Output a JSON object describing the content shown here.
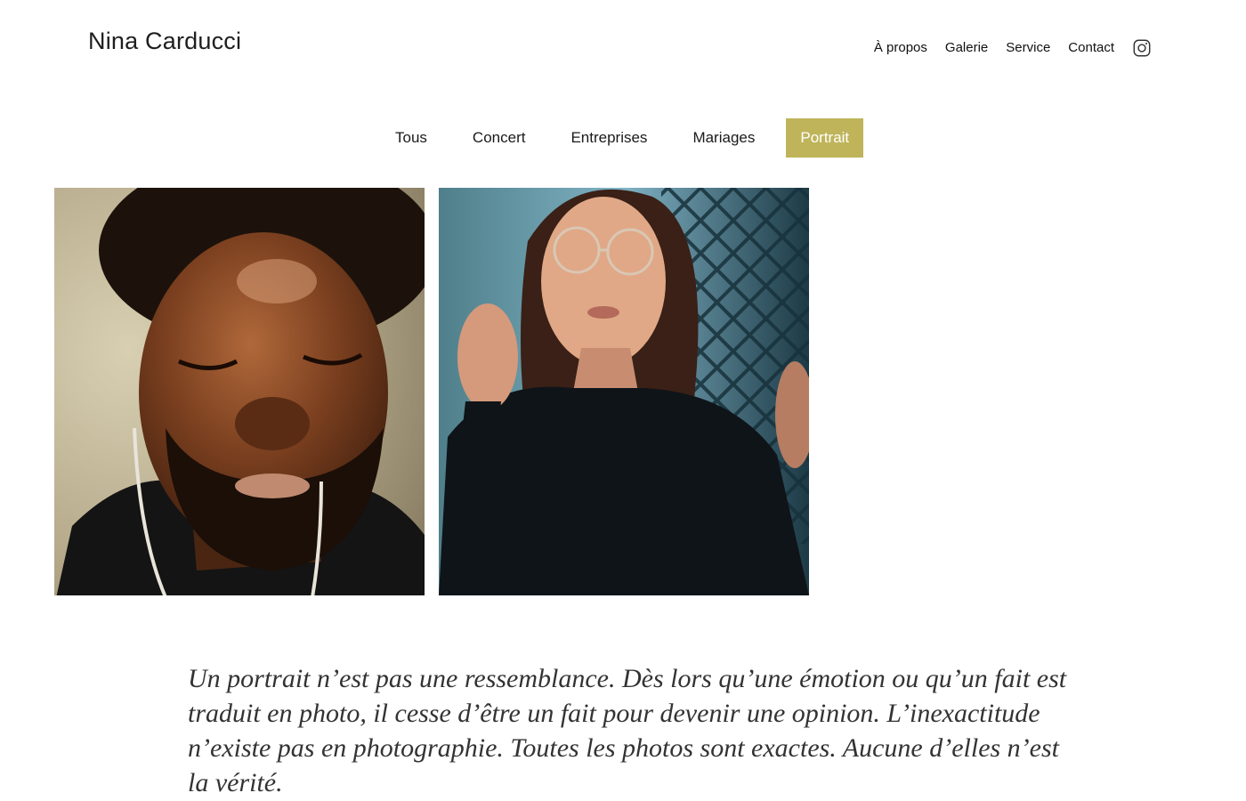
{
  "header": {
    "brand": "Nina Carducci",
    "nav": [
      "À propos",
      "Galerie",
      "Service",
      "Contact"
    ],
    "instagram_icon": "instagram-icon"
  },
  "filters": {
    "items": [
      "Tous",
      "Concert",
      "Entreprises",
      "Mariages",
      "Portrait"
    ],
    "active": "Portrait",
    "active_color": "#bfb45a"
  },
  "gallery": {
    "photos": [
      {
        "description_icon": "portrait-photo-man"
      },
      {
        "description_icon": "portrait-photo-woman"
      }
    ]
  },
  "quote": "Un portrait n’est pas une ressemblance. Dès lors qu’une émotion ou qu’un fait est traduit en photo, il cesse d’être un fait pour devenir une opinion. L’inexactitude n’existe pas en photographie. Toutes les photos sont exactes. Aucune d’elles n’est la vérité."
}
